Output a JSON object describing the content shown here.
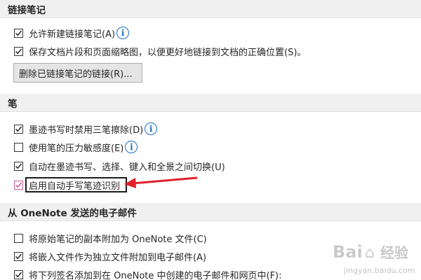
{
  "sections": {
    "links": {
      "title": "链接笔记",
      "opt1": "允许新建链接笔记(A)",
      "opt2": "保存文档片段和页面缩略图，以便更好地链接到文档的正确位置(S)。",
      "button": "删除已链接笔记的链接(R)..."
    },
    "pen": {
      "title": "笔",
      "opt1": "墨迹书写时禁用三笔擦除(D)",
      "opt2": "使用笔的压力敏感度(E)",
      "opt3": "自动在墨迹书写、选择、键入和全景之间切换(U)",
      "opt4": "启用自动手写笔迹识别"
    },
    "email": {
      "title": "从 OneNote 发送的电子邮件",
      "opt1": "将原始笔记的副本附加为 OneNote 文件(C)",
      "opt2": "将嵌入文件作为独立文件附加到电子邮件(A)",
      "opt3": "将下列签名添加到在 OneNote 中创建的电子邮件和网页中(F):"
    }
  },
  "checked": {
    "links_opt1": true,
    "links_opt2": true,
    "pen_opt1": true,
    "pen_opt2": false,
    "pen_opt3": true,
    "pen_opt4": true,
    "email_opt1": false,
    "email_opt2": true,
    "email_opt3": true
  },
  "watermark": {
    "brand": "Bai",
    "brand2": "经验",
    "url": "jingyan.baidu.com"
  },
  "colors": {
    "info": "#1e6fc7",
    "arrow": "#e0202a",
    "header_bg": "#f0f0f0"
  }
}
